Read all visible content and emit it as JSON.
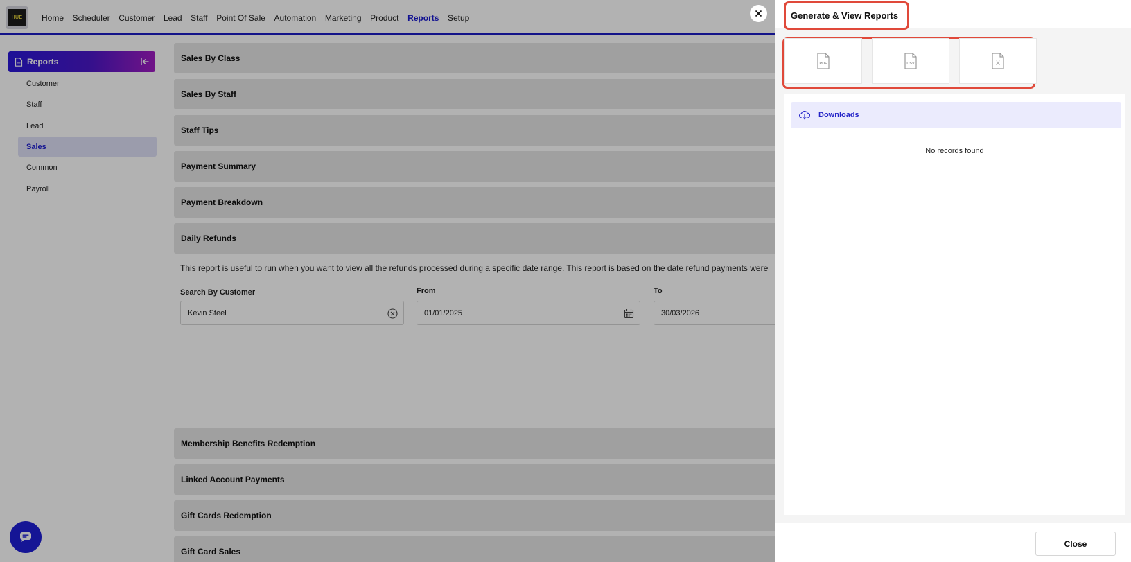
{
  "app": {
    "logo_text": "HUE"
  },
  "nav": {
    "items": [
      "Home",
      "Scheduler",
      "Customer",
      "Lead",
      "Staff",
      "Point Of Sale",
      "Automation",
      "Marketing",
      "Product",
      "Reports",
      "Setup"
    ],
    "active": "Reports"
  },
  "sidebar": {
    "title": "Reports",
    "items": [
      "Customer",
      "Staff",
      "Lead",
      "Sales",
      "Common",
      "Payroll"
    ],
    "active": "Sales"
  },
  "main": {
    "sections_top": [
      "Sales By Class",
      "Sales By Staff",
      "Staff Tips",
      "Payment Summary",
      "Payment Breakdown",
      "Daily Refunds"
    ],
    "description": "This report is useful to run when you want to view all the refunds processed during a specific date range. This report is based on the date refund payments were",
    "search_label": "Search By Customer",
    "search_value": "Kevin Steel",
    "from_label": "From",
    "from_value": "01/01/2025",
    "to_label": "To",
    "to_value": "30/03/2026",
    "sections_bottom": [
      "Membership Benefits Redemption",
      "Linked Account Payments",
      "Gift Cards Redemption",
      "Gift Card Sales"
    ]
  },
  "panel": {
    "title": "Generate & View Reports",
    "formats": [
      {
        "icon": "pdf-file-icon",
        "label": "PDF"
      },
      {
        "icon": "csv-file-icon",
        "label": "CSV"
      },
      {
        "icon": "excel-file-icon",
        "label": "X"
      }
    ],
    "downloads_label": "Downloads",
    "empty_text": "No records found",
    "close_label": "Close"
  },
  "colors": {
    "accent": "#1a1ad0",
    "highlight": "#e0493a",
    "gradient_start": "#2a18d8",
    "gradient_end": "#a21cc2"
  }
}
